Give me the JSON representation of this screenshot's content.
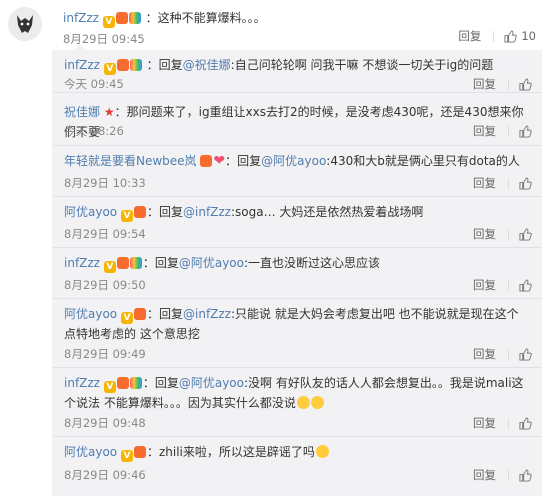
{
  "main_comment": {
    "username": "infZzz",
    "text": "：这种不能算爆料。。。",
    "time": "8月29日 09:45",
    "reply_label": "回复",
    "like_count": "10"
  },
  "replies": [
    {
      "username": "infZzz",
      "reply_word": "回复",
      "mention": "@祝佳娜",
      "text": ":自己问轮轮啊 问我干嘛 不想谈一切关于ig的问题",
      "time": "今天 09:45",
      "reply_label": "回复",
      "like_count": ""
    },
    {
      "username": "祝佳娜",
      "reply_word": "",
      "mention": "",
      "text": "：那问题来了，ig重组让xxs去打2的时候，是没考虑430呢，还是430想来你们不要",
      "time": "今天 08:26",
      "reply_label": "回复",
      "like_count": ""
    },
    {
      "username": "年轻就是要看Newbee岚",
      "reply_word": "回复",
      "mention": "@阿优ayoo",
      "text": ":430和大b就是俩心里只有dota的人",
      "time": "8月29日 10:33",
      "reply_label": "回复",
      "like_count": ""
    },
    {
      "username": "阿优ayoo",
      "reply_word": "回复",
      "mention": "@infZzz",
      "text": ":soga… 大妈还是依然热爱着战场啊",
      "time": "8月29日 09:54",
      "reply_label": "回复",
      "like_count": ""
    },
    {
      "username": "infZzz",
      "reply_word": "回复",
      "mention": "@阿优ayoo",
      "text": ":一直也没断过这心思应该",
      "time": "8月29日 09:50",
      "reply_label": "回复",
      "like_count": ""
    },
    {
      "username": "阿优ayoo",
      "reply_word": "回复",
      "mention": "@infZzz",
      "text": ":只能说 就是大妈会考虑复出吧 也不能说就是现在这个点特地考虑的 这个意思挖",
      "time": "8月29日 09:49",
      "reply_label": "回复",
      "like_count": ""
    },
    {
      "username": "infZzz",
      "reply_word": "回复",
      "mention": "@阿优ayoo",
      "text": ":没啊 有好队友的话人人都会想复出。。我是说mali这个说法 不能算爆料。。。因为其实什么都没说",
      "time": "8月29日 09:48",
      "reply_label": "回复",
      "like_count": ""
    },
    {
      "username": "阿优ayoo",
      "reply_word": "",
      "mention": "",
      "text": "：zhili来啦，所以这是辟谣了吗",
      "time": "8月29日 09:46",
      "reply_label": "回复",
      "like_count": ""
    }
  ]
}
